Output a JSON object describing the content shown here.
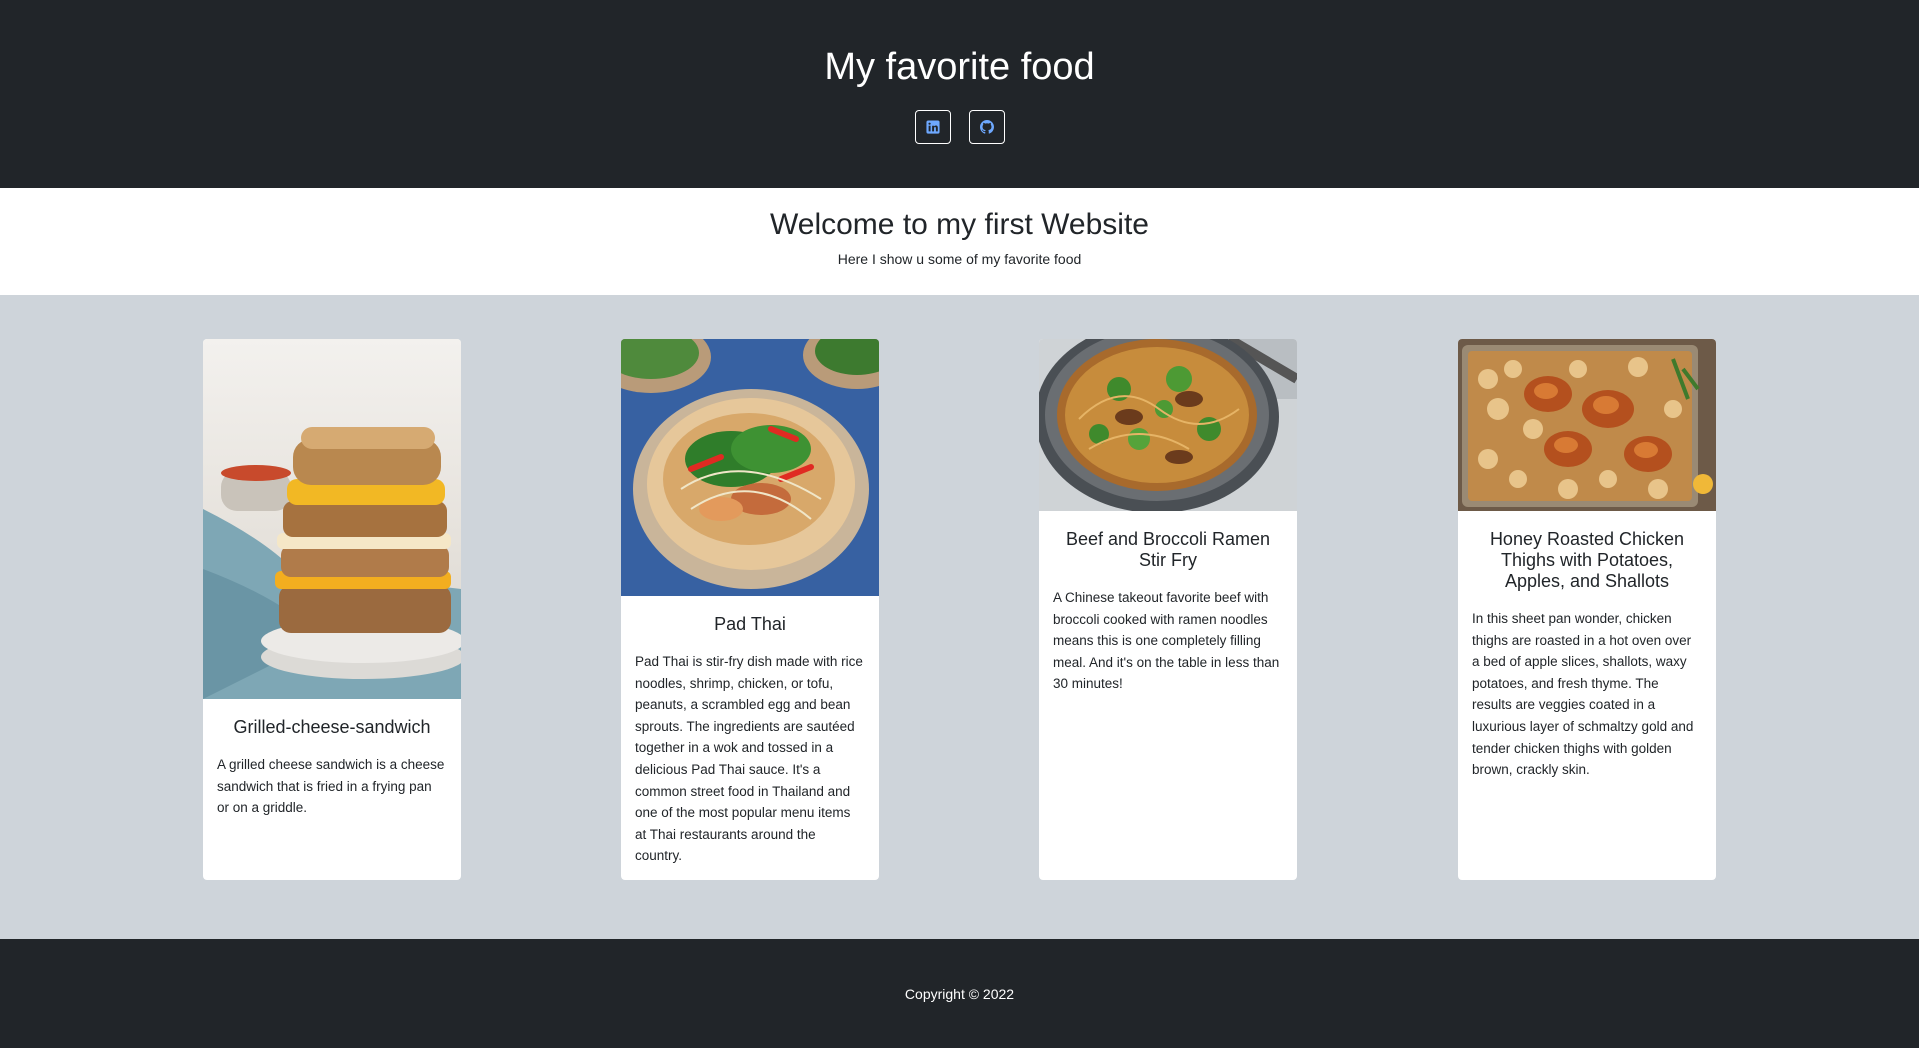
{
  "header": {
    "title": "My favorite food",
    "social": [
      {
        "icon": "linkedin-icon"
      },
      {
        "icon": "github-icon"
      }
    ]
  },
  "welcome": {
    "title": "Welcome to my first Website",
    "subtitle": "Here I show u some of my favorite food"
  },
  "cards": [
    {
      "title": "Grilled-cheese-sandwich",
      "text": "A grilled cheese sandwich is a cheese sandwich that is fried in a frying pan or on a griddle."
    },
    {
      "title": "Pad Thai",
      "text": "Pad Thai is stir-fry dish made with rice noodles, shrimp, chicken, or tofu, peanuts, a scrambled egg and bean sprouts. The ingredients are sautéed together in a wok and tossed in a delicious Pad Thai sauce. It's a common street food in Thailand and one of the most popular menu items at Thai restaurants around the country."
    },
    {
      "title": "Beef and Broccoli Ramen Stir Fry",
      "text": "A Chinese takeout favorite beef with broccoli cooked with ramen noodles means this is one completely filling meal. And it's on the table in less than 30 minutes!"
    },
    {
      "title": "Honey Roasted Chicken Thighs with Potatoes, Apples, and Shallots",
      "text": "In this sheet pan wonder, chicken thighs are roasted in a hot oven over a bed of apple slices, shallots, waxy potatoes, and fresh thyme. The results are veggies coated in a luxurious layer of schmaltzy gold and tender chicken thighs with golden brown, crackly skin."
    }
  ],
  "footer": {
    "copyright": "Copyright © 2022"
  },
  "colors": {
    "dark": "#212529",
    "section_bg": "#ced4da",
    "icon_accent": "#6ea8fe"
  }
}
